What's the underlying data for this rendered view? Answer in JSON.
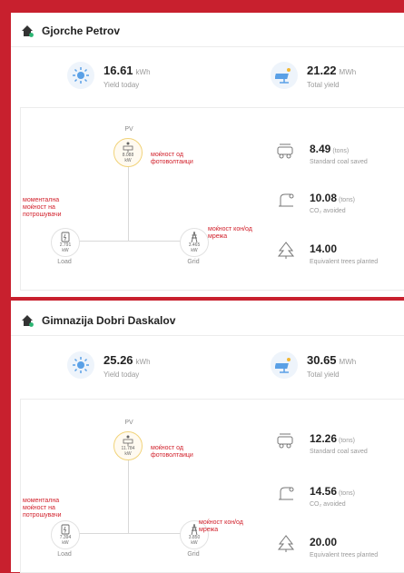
{
  "colors": {
    "accent_red": "#d11f2a",
    "background_red": "#c8202e",
    "pv_ring": "#f1d37a"
  },
  "sites": [
    {
      "name": "Gjorche Petrov",
      "yield_today": {
        "value": "16.61",
        "unit": "kWh",
        "label": "Yield today"
      },
      "total_yield": {
        "value": "21.22",
        "unit": "MWh",
        "label": "Total yield"
      },
      "flow": {
        "pv": {
          "label": "PV",
          "value": "8.088",
          "unit": "kW"
        },
        "load": {
          "label": "Load",
          "value": "2.791",
          "unit": "kW"
        },
        "grid": {
          "label": "Grid",
          "value": "3.465",
          "unit": "kW"
        }
      },
      "notes": {
        "pv": "моќност од фотоволтаици",
        "load": "моментална моќност на потрошувачи",
        "grid": "моќност кон/од мрежа"
      },
      "metrics": [
        {
          "value": "8.49",
          "unit": "(tons)",
          "label": "Standard coal saved",
          "icon": "coal-icon"
        },
        {
          "value": "10.08",
          "unit": "(tons)",
          "label": "CO₂ avoided",
          "icon": "co2-icon"
        },
        {
          "value": "14.00",
          "unit": "",
          "label": "Equivalent trees planted",
          "icon": "tree-icon"
        }
      ]
    },
    {
      "name": "Gimnazija Dobri Daskalov",
      "yield_today": {
        "value": "25.26",
        "unit": "kWh",
        "label": "Yield today"
      },
      "total_yield": {
        "value": "30.65",
        "unit": "MWh",
        "label": "Total yield"
      },
      "flow": {
        "pv": {
          "label": "PV",
          "value": "11.784",
          "unit": "kW"
        },
        "load": {
          "label": "Load",
          "value": "7.394",
          "unit": "kW"
        },
        "grid": {
          "label": "Grid",
          "value": "3.850",
          "unit": "kW"
        }
      },
      "notes": {
        "pv": "моќност од фотоволтаици",
        "load": "моментална моќност на потрошувачи",
        "grid": "моќност кон/од мрежа"
      },
      "metrics": [
        {
          "value": "12.26",
          "unit": "(tons)",
          "label": "Standard coal saved",
          "icon": "coal-icon"
        },
        {
          "value": "14.56",
          "unit": "(tons)",
          "label": "CO₂ avoided",
          "icon": "co2-icon"
        },
        {
          "value": "20.00",
          "unit": "",
          "label": "Equivalent trees planted",
          "icon": "tree-icon"
        }
      ]
    }
  ]
}
